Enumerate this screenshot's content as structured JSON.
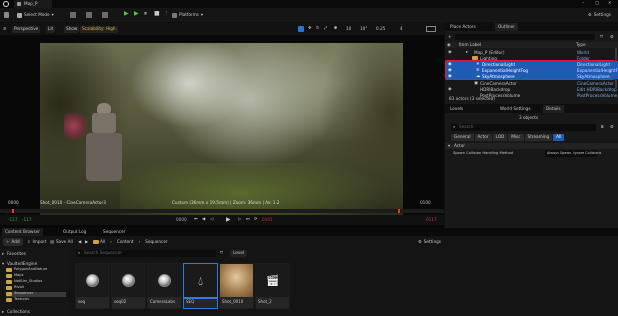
{
  "titlebar": {
    "tab": "Map_P"
  },
  "toolbar": {
    "select_mode": "Select Mode",
    "platforms": "Platforms",
    "settings": "Settings"
  },
  "viewport": {
    "perspective": "Perspective",
    "lit": "Lit",
    "show": "Show",
    "scalability": "Scalability: High",
    "snap_grid": "10",
    "snap_rot": "10°",
    "snap_scale": "0.25",
    "cam_speed": "4",
    "camera_label": "Shot_0010 - CineCameraActor3",
    "camera_info": "Custom (36mm x 19.5mm) | Zoom: 36mm | Av: 1.2",
    "frame_left": "0000",
    "frame_right": "0100",
    "time_start": "-117",
    "time_start2": "-117",
    "time_cur": "0000",
    "time_end": "0101",
    "time_end2": "0117"
  },
  "outliner": {
    "tab_place": "Place Actors",
    "tab_outliner": "Outliner",
    "col_label": "Item Label",
    "col_type": "Type",
    "rows": [
      {
        "label": "Map_P (Editor)",
        "type": "World"
      },
      {
        "label": "Lighting",
        "type": "Folder"
      },
      {
        "label": "DirectionalLight",
        "type": "DirectionalLight"
      },
      {
        "label": "ExponentialHeightFog",
        "type": "ExponentialHeightFo"
      },
      {
        "label": "SkyAtmosphere",
        "type": "SkyAtmosphere"
      },
      {
        "label": "CineCameraActor",
        "type": "CineCameraActor"
      },
      {
        "label": "HDRIBackdrop",
        "type": "Edit HDRIBackdrop"
      },
      {
        "label": "PostProcessVolume",
        "type": "PostProcessVolume"
      }
    ],
    "status": "83 actors (3 selected)"
  },
  "details": {
    "tab_levels": "Levels",
    "tab_world": "World Settings",
    "tab_details": "Details",
    "objects": "3 objects",
    "search_placeholder": "Search",
    "filters": [
      "General",
      "Actor",
      "LOD",
      "Misc",
      "Streaming",
      "All"
    ],
    "section": "Actor",
    "prop_label": "Spawn Collision Handling Method",
    "prop_value": "Always Spawn, Ignore Collisions"
  },
  "bottom": {
    "tab_content": "Content Browser",
    "tab_output": "Output Log",
    "tab_sequencer": "Sequencer",
    "add": "Add",
    "import": "Import",
    "save_all": "Save All",
    "crumbs": [
      "All",
      "Content",
      "Sequencer"
    ],
    "settings": "Settings",
    "favorites": "Favorites",
    "project": "VaultedEngine",
    "tree": [
      "PolygonAndNature",
      "Maps",
      "NatSim_Studios",
      "Rivoli",
      "Sequencer",
      "Textures"
    ],
    "collections": "Collections",
    "search_placeholder": "Search Sequencer",
    "level": "Level",
    "assets": [
      {
        "label": "seq",
        "kind": "ball"
      },
      {
        "label": "seq02",
        "kind": "ball"
      },
      {
        "label": "CameraLabs",
        "kind": "ball"
      },
      {
        "label": "SEQ",
        "kind": "drop"
      },
      {
        "label": "Shot_0010",
        "kind": "image"
      },
      {
        "label": "Shot_2",
        "kind": "clapper"
      }
    ]
  }
}
